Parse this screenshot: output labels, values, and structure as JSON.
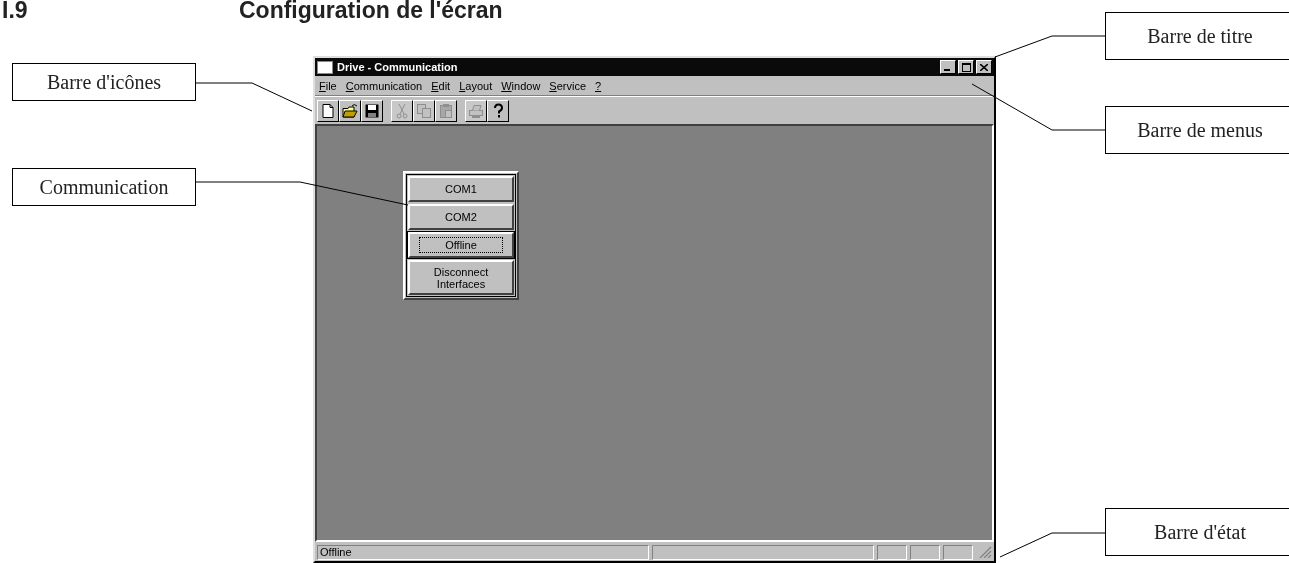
{
  "heading": {
    "number": "I.9",
    "title": "Configuration de l'écran"
  },
  "window": {
    "title": "Drive - Communication"
  },
  "menu": [
    {
      "label": "File"
    },
    {
      "label": "Communication"
    },
    {
      "label": "Edit"
    },
    {
      "label": "Layout"
    },
    {
      "label": "Window"
    },
    {
      "label": "Service"
    },
    {
      "label": "?"
    }
  ],
  "toolbar": [
    {
      "kind": "new",
      "disabled": false
    },
    {
      "kind": "open",
      "disabled": false
    },
    {
      "kind": "save",
      "disabled": false
    },
    {
      "kind": "sep"
    },
    {
      "kind": "cut",
      "disabled": true
    },
    {
      "kind": "copy",
      "disabled": true
    },
    {
      "kind": "paste",
      "disabled": true
    },
    {
      "kind": "sep"
    },
    {
      "kind": "print",
      "disabled": true
    },
    {
      "kind": "help",
      "disabled": false
    }
  ],
  "communication_panel": {
    "buttons": [
      {
        "label": "COM1",
        "selected": false
      },
      {
        "label": "COM2",
        "selected": false
      },
      {
        "label": "Offline",
        "selected": true
      },
      {
        "label": "Disconnect Interfaces",
        "selected": false
      }
    ]
  },
  "status_bar": {
    "text": "Offline"
  },
  "callouts": [
    {
      "label": "Barre d'icônes"
    },
    {
      "label": "Communication"
    },
    {
      "label": "Barre de titre"
    },
    {
      "label": "Barre de menus"
    },
    {
      "label": "Barre d'état"
    }
  ]
}
